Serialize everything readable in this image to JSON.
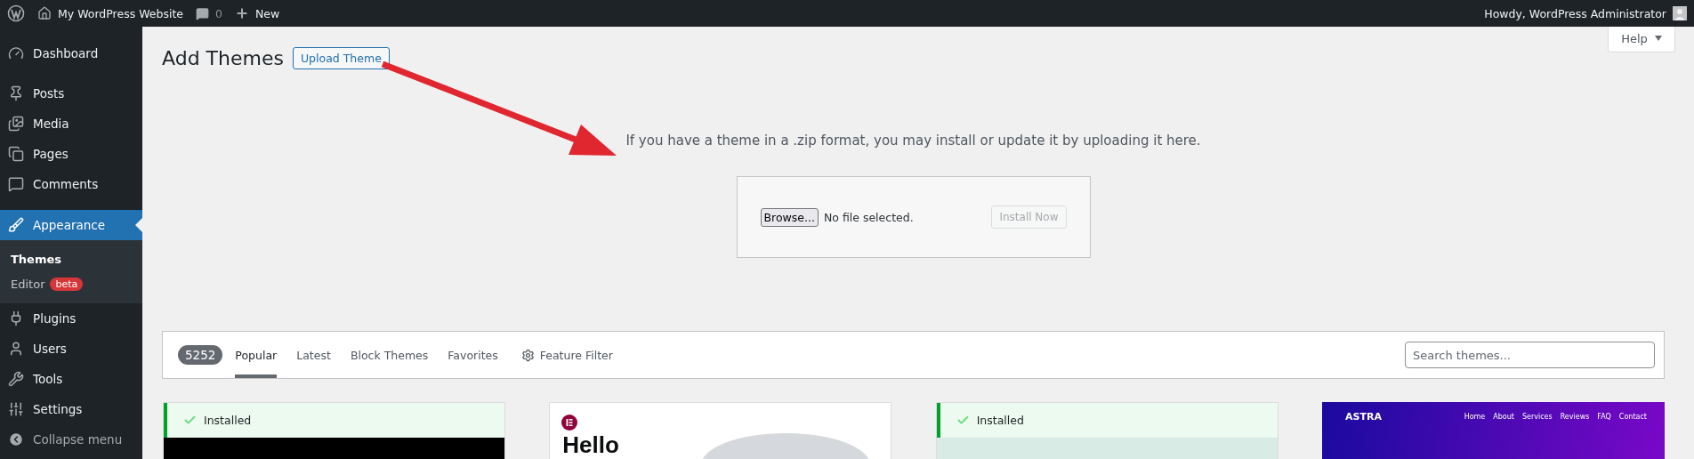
{
  "admin_bar": {
    "site_name": "My WordPress Website",
    "comments_count": "0",
    "new_label": "New",
    "greeting": "Howdy, WordPress Administrator"
  },
  "sidebar": {
    "items": [
      {
        "label": "Dashboard",
        "selected": false
      },
      {
        "label": "Posts",
        "selected": false
      },
      {
        "label": "Media",
        "selected": false
      },
      {
        "label": "Pages",
        "selected": false
      },
      {
        "label": "Comments",
        "selected": false
      },
      {
        "label": "Appearance",
        "selected": true,
        "children": [
          {
            "label": "Themes",
            "selected": true
          },
          {
            "label": "Editor",
            "selected": false,
            "badge": "beta"
          }
        ]
      },
      {
        "label": "Plugins",
        "selected": false
      },
      {
        "label": "Users",
        "selected": false
      },
      {
        "label": "Tools",
        "selected": false
      },
      {
        "label": "Settings",
        "selected": false
      }
    ],
    "collapse_label": "Collapse menu"
  },
  "page": {
    "title": "Add Themes",
    "upload_button": "Upload Theme",
    "help": "Help"
  },
  "upload": {
    "description": "If you have a theme in a .zip format, you may install or update it by uploading it here.",
    "browse": "Browse...",
    "file_status": "No file selected.",
    "install": "Install Now",
    "install_disabled": true
  },
  "filter_bar": {
    "count": "5252",
    "tabs": [
      {
        "label": "Popular",
        "selected": true
      },
      {
        "label": "Latest",
        "selected": false
      },
      {
        "label": "Block Themes",
        "selected": false
      },
      {
        "label": "Favorites",
        "selected": false
      }
    ],
    "feature_filter": "Feature Filter",
    "search": {
      "placeholder": "Search themes..."
    }
  },
  "themes": [
    {
      "kind": "dark",
      "installed": true,
      "installed_label": "Installed"
    },
    {
      "kind": "hello",
      "installed": false,
      "heading": "Hello"
    },
    {
      "kind": "light",
      "installed": true,
      "installed_label": "Installed"
    },
    {
      "kind": "astra",
      "installed": false,
      "logo": "ASTRA",
      "nav": [
        "Home",
        "About",
        "Services",
        "Reviews",
        "FAQ",
        "Contact"
      ]
    }
  ]
}
